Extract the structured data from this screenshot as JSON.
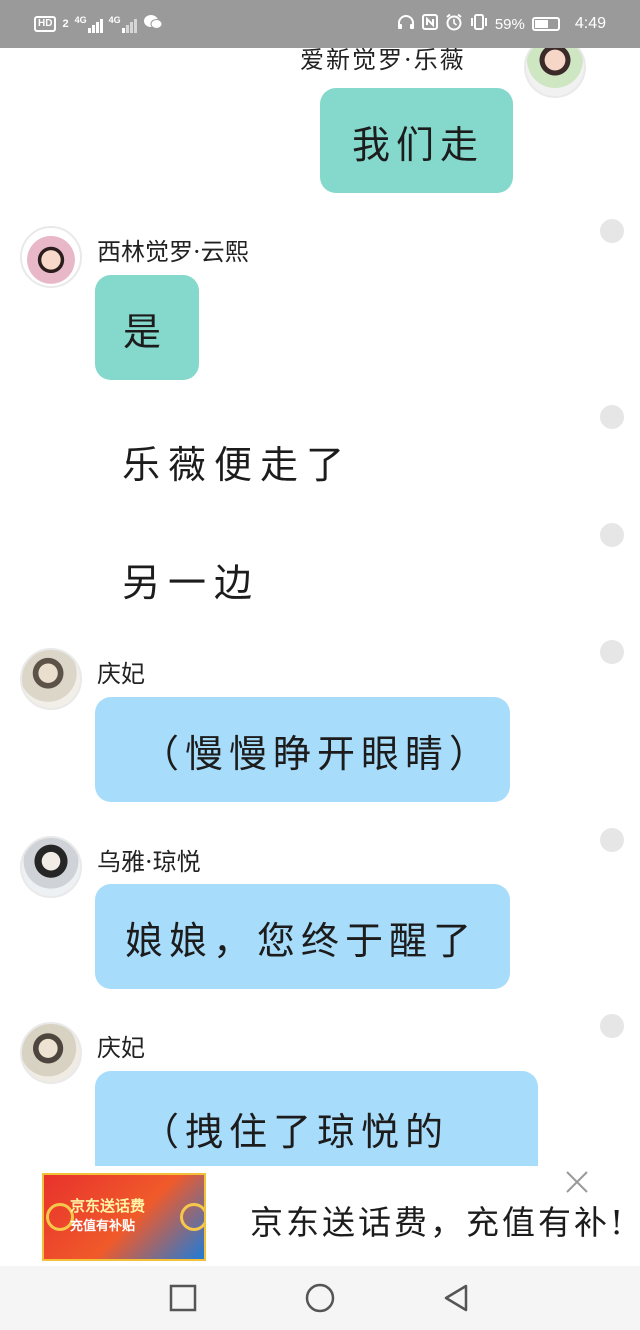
{
  "status_bar": {
    "hd_badge": "HD",
    "sim_number": "2",
    "network_1": "4G",
    "network_2": "4G",
    "battery_percent_label": "59%",
    "battery_level": 0.59,
    "time": "4:49",
    "icons": [
      "hd-icon",
      "signal-icon",
      "signal-icon",
      "wechat-icon",
      "headphones-icon",
      "nfc-icon",
      "alarm-icon",
      "vibrate-icon",
      "battery-icon"
    ]
  },
  "messages": [
    {
      "speaker": "爱新觉罗·乐薇",
      "side": "right",
      "text": "我们走",
      "bubble_color": "#84d8cc"
    },
    {
      "speaker": "西林觉罗·云熙",
      "side": "left",
      "text": "是",
      "bubble_color": "#84d8cc"
    },
    {
      "type": "narration",
      "text": "乐薇便走了"
    },
    {
      "type": "narration",
      "text": "另一边"
    },
    {
      "speaker": "庆妃",
      "side": "left",
      "text": "（慢慢睁开眼睛）",
      "bubble_color": "#a8dcfb"
    },
    {
      "speaker": "乌雅·琼悦",
      "side": "left",
      "text": "娘娘，您终于醒了",
      "bubble_color": "#a8dcfb"
    },
    {
      "speaker": "庆妃",
      "side": "left",
      "text": "（拽住了琼悦的",
      "bubble_color": "#a8dcfb"
    }
  ],
  "ad": {
    "image_title": "京东送话费",
    "image_subtitle": "充值有补贴",
    "text": "京东送话费，充值有补!",
    "close_icon": "close-icon"
  },
  "nav_bar": {
    "icons": [
      "recent-apps-icon",
      "home-icon",
      "back-icon"
    ]
  }
}
